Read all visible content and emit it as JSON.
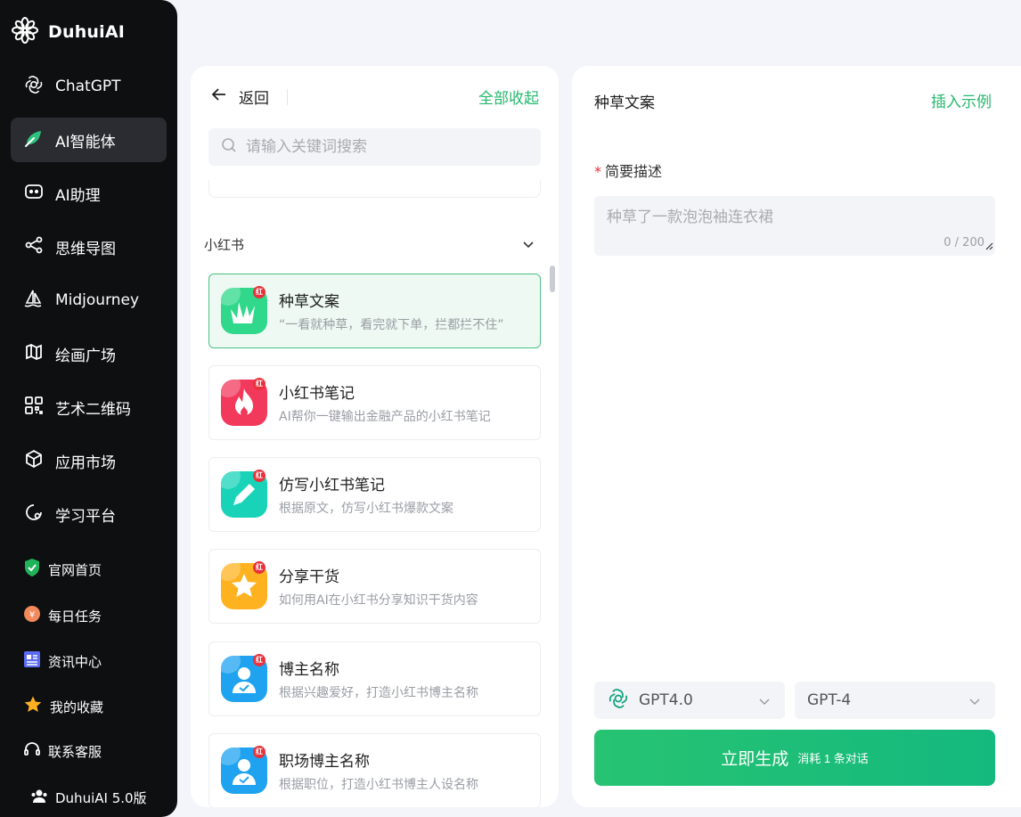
{
  "brand": {
    "name": "DuhuiAI"
  },
  "sidebar": {
    "items": [
      {
        "label": "ChatGPT",
        "icon": "openai-icon"
      },
      {
        "label": "AI智能体",
        "icon": "leaf-icon",
        "active": true
      },
      {
        "label": "AI助理",
        "icon": "robot-icon"
      },
      {
        "label": "思维导图",
        "icon": "mindmap-icon"
      },
      {
        "label": "Midjourney",
        "icon": "sailboat-icon"
      },
      {
        "label": "绘画广场",
        "icon": "map-icon"
      },
      {
        "label": "艺术二维码",
        "icon": "qrcode-icon"
      },
      {
        "label": "应用市场",
        "icon": "cube-icon"
      },
      {
        "label": "学习平台",
        "icon": "learn-icon"
      }
    ],
    "sub_items": [
      {
        "label": "官网首页",
        "icon": "shield-check-icon"
      },
      {
        "label": "每日任务",
        "icon": "coin-icon"
      },
      {
        "label": "资讯中心",
        "icon": "news-icon"
      },
      {
        "label": "我的收藏",
        "icon": "star-icon"
      },
      {
        "label": "联系客服",
        "icon": "headset-icon"
      }
    ],
    "version": "DuhuiAI 5.0版"
  },
  "middle": {
    "back_label": "返回",
    "collapse_all": "全部收起",
    "search_placeholder": "请输入关键词搜索",
    "section_title": "小红书",
    "badge": "红",
    "cards": [
      {
        "title": "种草文案",
        "desc": "“一看就种草，看完就下单，拦都拦不住”",
        "color": "#2fd88a",
        "icon": "grass-icon",
        "selected": true
      },
      {
        "title": "小红书笔记",
        "desc": "AI帮你一键输出金融产品的小红书笔记",
        "color": "#f2395c",
        "icon": "fire-icon"
      },
      {
        "title": "仿写小红书笔记",
        "desc": "根据原文，仿写小红书爆款文案",
        "color": "#18d3b8",
        "icon": "pencil-icon"
      },
      {
        "title": "分享干货",
        "desc": "如何用AI在小红书分享知识干货内容",
        "color": "#ffb21f",
        "icon": "star-icon"
      },
      {
        "title": "博主名称",
        "desc": "根据兴趣爱好，打造小红书博主名称",
        "color": "#1fa3f0",
        "icon": "person-icon"
      },
      {
        "title": "职场博主名称",
        "desc": "根据职位，打造小红书博主人设名称",
        "color": "#1fa3f0",
        "icon": "person-icon"
      }
    ]
  },
  "right": {
    "title": "种草文案",
    "insert_example": "插入示例",
    "field_label": "简要描述",
    "required_mark": "*",
    "textarea_placeholder": "种草了一款泡泡袖连衣裙",
    "counter": "0 / 200",
    "model_select": "GPT4.0",
    "version_select": "GPT-4",
    "generate_label": "立即生成",
    "generate_sub": "消耗 1 条对话"
  },
  "colors": {
    "accent": "#24b86c",
    "sidebar_bg": "#0e0f11",
    "badge": "#e8323c"
  }
}
